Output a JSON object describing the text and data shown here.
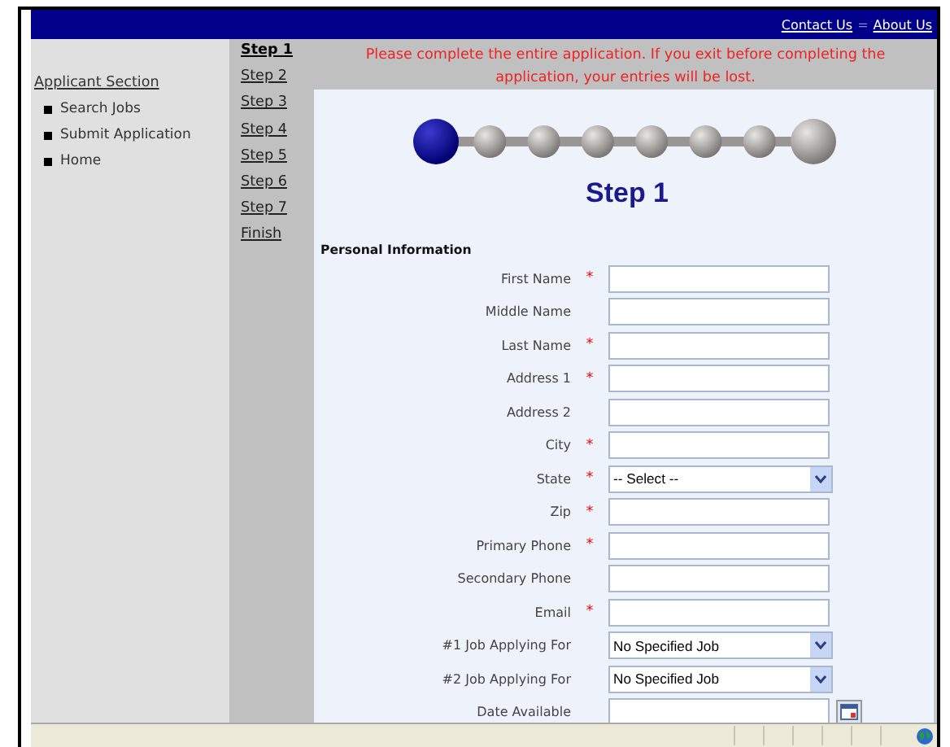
{
  "header": {
    "links": [
      {
        "label": "Contact Us"
      },
      {
        "label": "About Us"
      }
    ],
    "separator": "="
  },
  "sidebar": {
    "title": "Applicant Section",
    "items": [
      {
        "label": "Search Jobs"
      },
      {
        "label": "Submit Application"
      },
      {
        "label": "Home"
      }
    ]
  },
  "steps": [
    {
      "label": "Step 1",
      "selected": true
    },
    {
      "label": "Step 2",
      "selected": false
    },
    {
      "label": "Step 3",
      "selected": false
    },
    {
      "label": "Step 4",
      "selected": false
    },
    {
      "label": "Step 5",
      "selected": false
    },
    {
      "label": "Step 6",
      "selected": false
    },
    {
      "label": "Step 7",
      "selected": false
    },
    {
      "label": "Finish",
      "selected": false
    }
  ],
  "notice": "Please complete the entire application. If you exit before completing the application, your entries will be lost.",
  "heading": "Step 1",
  "section": "Personal Information",
  "fields": [
    {
      "label": "First Name",
      "required": true,
      "kind": "text"
    },
    {
      "label": "Middle Name",
      "required": false,
      "kind": "text"
    },
    {
      "label": "Last Name",
      "required": true,
      "kind": "text"
    },
    {
      "label": "Address 1",
      "required": true,
      "kind": "text"
    },
    {
      "label": "Address 2",
      "required": false,
      "kind": "text"
    },
    {
      "label": "City",
      "required": true,
      "kind": "text"
    },
    {
      "label": "State",
      "required": true,
      "kind": "select",
      "value": "-- Select --"
    },
    {
      "label": "Zip",
      "required": true,
      "kind": "text"
    },
    {
      "label": "Primary Phone",
      "required": true,
      "kind": "text"
    },
    {
      "label": "Secondary Phone",
      "required": false,
      "kind": "text"
    },
    {
      "label": "Email",
      "required": true,
      "kind": "text"
    },
    {
      "label": "#1 Job Applying For",
      "required": false,
      "kind": "select",
      "value": "No Specified Job"
    },
    {
      "label": "#2 Job Applying For",
      "required": false,
      "kind": "select",
      "value": "No Specified Job"
    },
    {
      "label": "Date Available",
      "required": false,
      "kind": "date"
    }
  ],
  "required_mark": "*"
}
